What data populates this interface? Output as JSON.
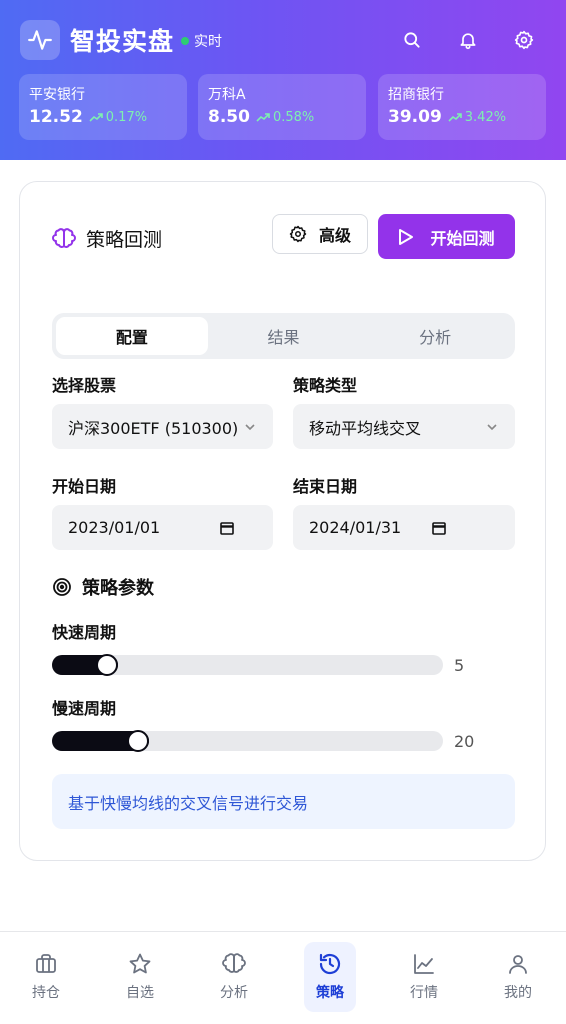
{
  "header": {
    "title": "智投实盘",
    "live_label": "实时"
  },
  "tickers": [
    {
      "name": "平安银行",
      "price": "12.52",
      "change": "0.17%"
    },
    {
      "name": "万科A",
      "price": "8.50",
      "change": "0.58%"
    },
    {
      "name": "招商银行",
      "price": "39.09",
      "change": "3.42%"
    }
  ],
  "card": {
    "title": "策略回测",
    "advanced_label": "高级",
    "run_label": "开始回测",
    "tabs": [
      "配置",
      "结果",
      "分析"
    ],
    "active_tab": "配置"
  },
  "form": {
    "stock_label": "选择股票",
    "stock_value": "沪深300ETF (510300)",
    "strategy_label": "策略类型",
    "strategy_value": "移动平均线交叉",
    "start_label": "开始日期",
    "start_value": "2023/01/01",
    "end_label": "结束日期",
    "end_value": "2024/01/31"
  },
  "params": {
    "section_title": "策略参数",
    "fast_label": "快速周期",
    "fast_value": "5",
    "fast_fraction": 0.14,
    "slow_label": "慢速周期",
    "slow_value": "20",
    "slow_fraction": 0.22
  },
  "description": "基于快慢均线的交叉信号进行交易",
  "nav": [
    {
      "label": "持仓",
      "icon": "briefcase-icon"
    },
    {
      "label": "自选",
      "icon": "star-icon"
    },
    {
      "label": "分析",
      "icon": "brain-icon"
    },
    {
      "label": "策略",
      "icon": "history-icon",
      "active": true
    },
    {
      "label": "行情",
      "icon": "chart-line-icon"
    },
    {
      "label": "我的",
      "icon": "user-icon"
    }
  ],
  "colors": {
    "accent": "#9333ea",
    "positive": "#7ef0b0",
    "nav_active": "#1e3fd6"
  }
}
